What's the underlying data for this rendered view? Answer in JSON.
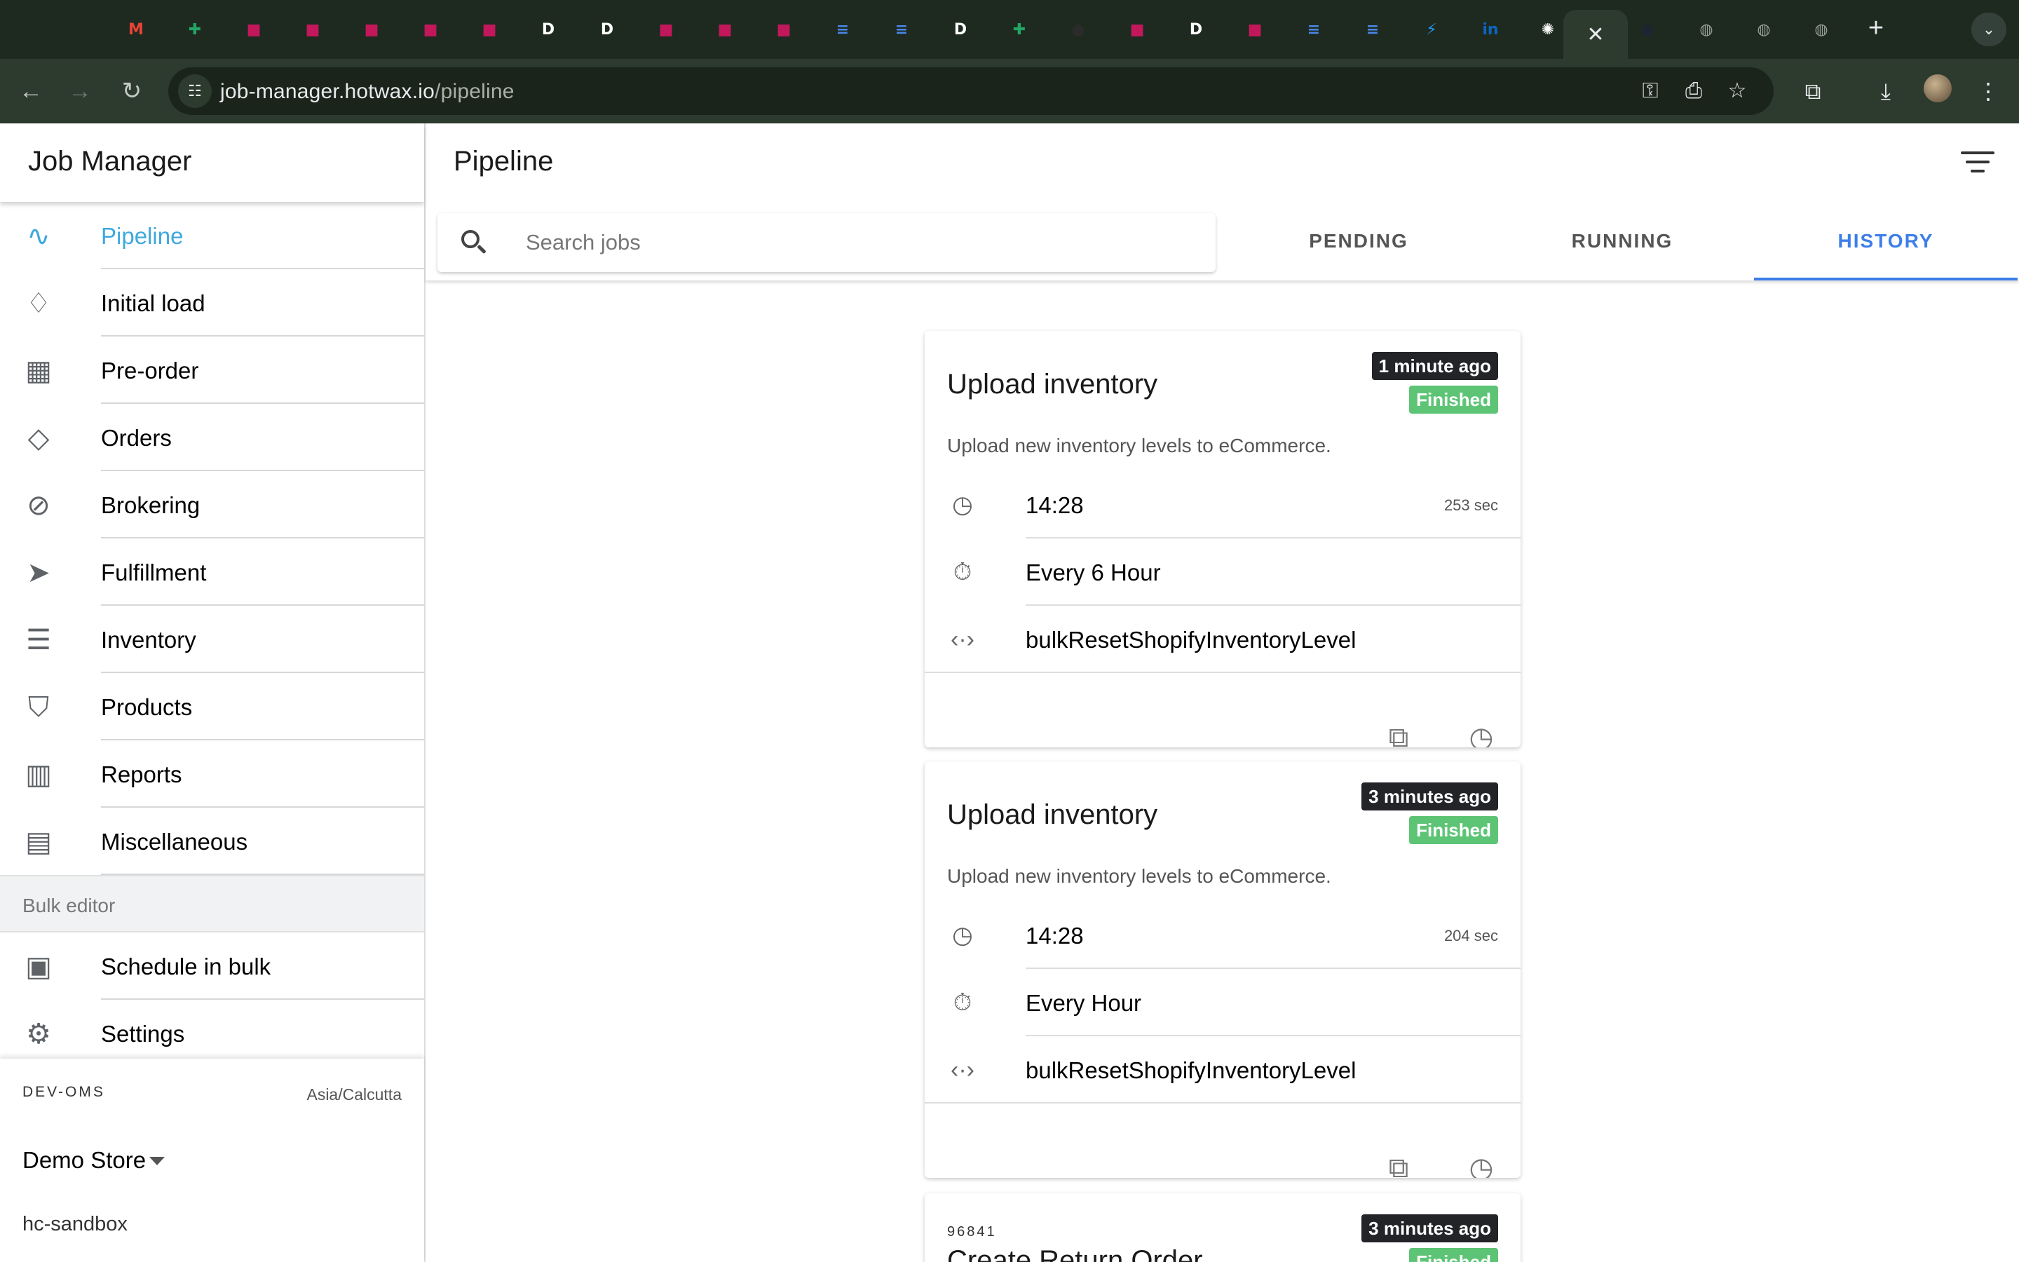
{
  "browser": {
    "tabs": [
      {
        "icon": "gmail-icon",
        "glyph": "M",
        "color": "#ea4335"
      },
      {
        "icon": "sheets-icon",
        "glyph": "✚",
        "color": "#22a565"
      },
      {
        "icon": "app-icon",
        "glyph": "■",
        "color": "#c2185b"
      },
      {
        "icon": "app-icon",
        "glyph": "■",
        "color": "#c2185b"
      },
      {
        "icon": "app-icon",
        "glyph": "■",
        "color": "#c2185b"
      },
      {
        "icon": "app-icon",
        "glyph": "■",
        "color": "#c2185b"
      },
      {
        "icon": "app-icon",
        "glyph": "■",
        "color": "#c2185b"
      },
      {
        "icon": "d-icon",
        "glyph": "D",
        "color": "#ffffff"
      },
      {
        "icon": "d-icon",
        "glyph": "D",
        "color": "#ffffff"
      },
      {
        "icon": "app-icon",
        "glyph": "■",
        "color": "#c2185b"
      },
      {
        "icon": "app-icon",
        "glyph": "■",
        "color": "#c2185b"
      },
      {
        "icon": "app-icon",
        "glyph": "■",
        "color": "#c2185b"
      },
      {
        "icon": "docs-icon",
        "glyph": "≡",
        "color": "#4a86e8"
      },
      {
        "icon": "docs-icon",
        "glyph": "≡",
        "color": "#4a86e8"
      },
      {
        "icon": "d-icon",
        "glyph": "D",
        "color": "#ffffff"
      },
      {
        "icon": "sheets-icon",
        "glyph": "✚",
        "color": "#22a565"
      },
      {
        "icon": "github-icon",
        "glyph": "●",
        "color": "#2b2b2b"
      },
      {
        "icon": "app-icon",
        "glyph": "■",
        "color": "#c2185b"
      },
      {
        "icon": "d-icon",
        "glyph": "D",
        "color": "#ffffff"
      },
      {
        "icon": "app-icon",
        "glyph": "■",
        "color": "#c2185b"
      },
      {
        "icon": "docs-icon",
        "glyph": "≡",
        "color": "#4a86e8"
      },
      {
        "icon": "docs-icon",
        "glyph": "≡",
        "color": "#4a86e8"
      },
      {
        "icon": "bolt-icon",
        "glyph": "⚡",
        "color": "#2196f3"
      },
      {
        "icon": "linkedin-icon",
        "glyph": "in",
        "color": "#0a66c2"
      },
      {
        "icon": "openai-icon",
        "glyph": "✺",
        "color": "#ffffff"
      },
      {
        "icon": "close-icon",
        "glyph": "✕",
        "color": "#e8eaed",
        "active": true
      },
      {
        "icon": "dark-icon",
        "glyph": "●",
        "color": "#1c2530"
      },
      {
        "icon": "globe-icon",
        "glyph": "◍",
        "color": "#9aa09a"
      },
      {
        "icon": "globe-icon",
        "glyph": "◍",
        "color": "#9aa09a"
      },
      {
        "icon": "globe-icon",
        "glyph": "◍",
        "color": "#9aa09a"
      }
    ],
    "new_tab": "+",
    "url_host": "job-manager.hotwax.io",
    "url_path": "/pipeline"
  },
  "sidebar": {
    "title": "Job Manager",
    "items": [
      {
        "label": "Pipeline",
        "icon": "pulse-icon",
        "glyph": "∿",
        "selected": true
      },
      {
        "label": "Initial load",
        "icon": "ice-cream-icon",
        "glyph": "♢"
      },
      {
        "label": "Pre-order",
        "icon": "calendar-icon",
        "glyph": "▦"
      },
      {
        "label": "Orders",
        "icon": "ticket-icon",
        "glyph": "◇"
      },
      {
        "label": "Brokering",
        "icon": "compass-icon",
        "glyph": "⊘"
      },
      {
        "label": "Fulfillment",
        "icon": "send-icon",
        "glyph": "➤"
      },
      {
        "label": "Inventory",
        "icon": "albums-icon",
        "glyph": "☰"
      },
      {
        "label": "Products",
        "icon": "shirt-icon",
        "glyph": "⛉"
      },
      {
        "label": "Reports",
        "icon": "bar-chart-icon",
        "glyph": "▥"
      },
      {
        "label": "Miscellaneous",
        "icon": "library-icon",
        "glyph": "▤"
      }
    ],
    "group_label": "Bulk editor",
    "bulk_items": [
      {
        "label": "Schedule in bulk",
        "icon": "terminal-icon",
        "glyph": "▣"
      },
      {
        "label": "Settings",
        "icon": "settings-icon",
        "glyph": "⚙"
      }
    ],
    "footer": {
      "instance": "DEV-OMS",
      "timezone": "Asia/Calcutta",
      "store": "Demo Store",
      "user": "hc-sandbox"
    }
  },
  "main": {
    "title": "Pipeline",
    "search_placeholder": "Search jobs",
    "segments": [
      {
        "label": "PENDING",
        "active": false
      },
      {
        "label": "RUNNING",
        "active": false
      },
      {
        "label": "HISTORY",
        "active": true
      }
    ],
    "jobs": [
      {
        "overline": "",
        "title": "Upload inventory",
        "time_ago": "1 minute ago",
        "status": "Finished",
        "description": "Upload new inventory levels to eCommerce.",
        "run_time": "14:28",
        "duration": "253 sec",
        "frequency": "Every 6 Hour",
        "service": "bulkResetShopifyInventoryLevel"
      },
      {
        "overline": "",
        "title": "Upload inventory",
        "time_ago": "3 minutes ago",
        "status": "Finished",
        "description": "Upload new inventory levels to eCommerce.",
        "run_time": "14:28",
        "duration": "204 sec",
        "frequency": "Every Hour",
        "service": "bulkResetShopifyInventoryLevel"
      },
      {
        "overline": "96841",
        "title": "Create Return Order",
        "time_ago": "3 minutes ago",
        "status": "Finished",
        "description": "",
        "run_time": "",
        "duration": "",
        "frequency": "",
        "service": ""
      }
    ]
  },
  "colors": {
    "accent": "#3d7ee8",
    "selected_menu": "#3fa8dd",
    "finished": "#5dc475",
    "badge_dark": "#222428"
  }
}
